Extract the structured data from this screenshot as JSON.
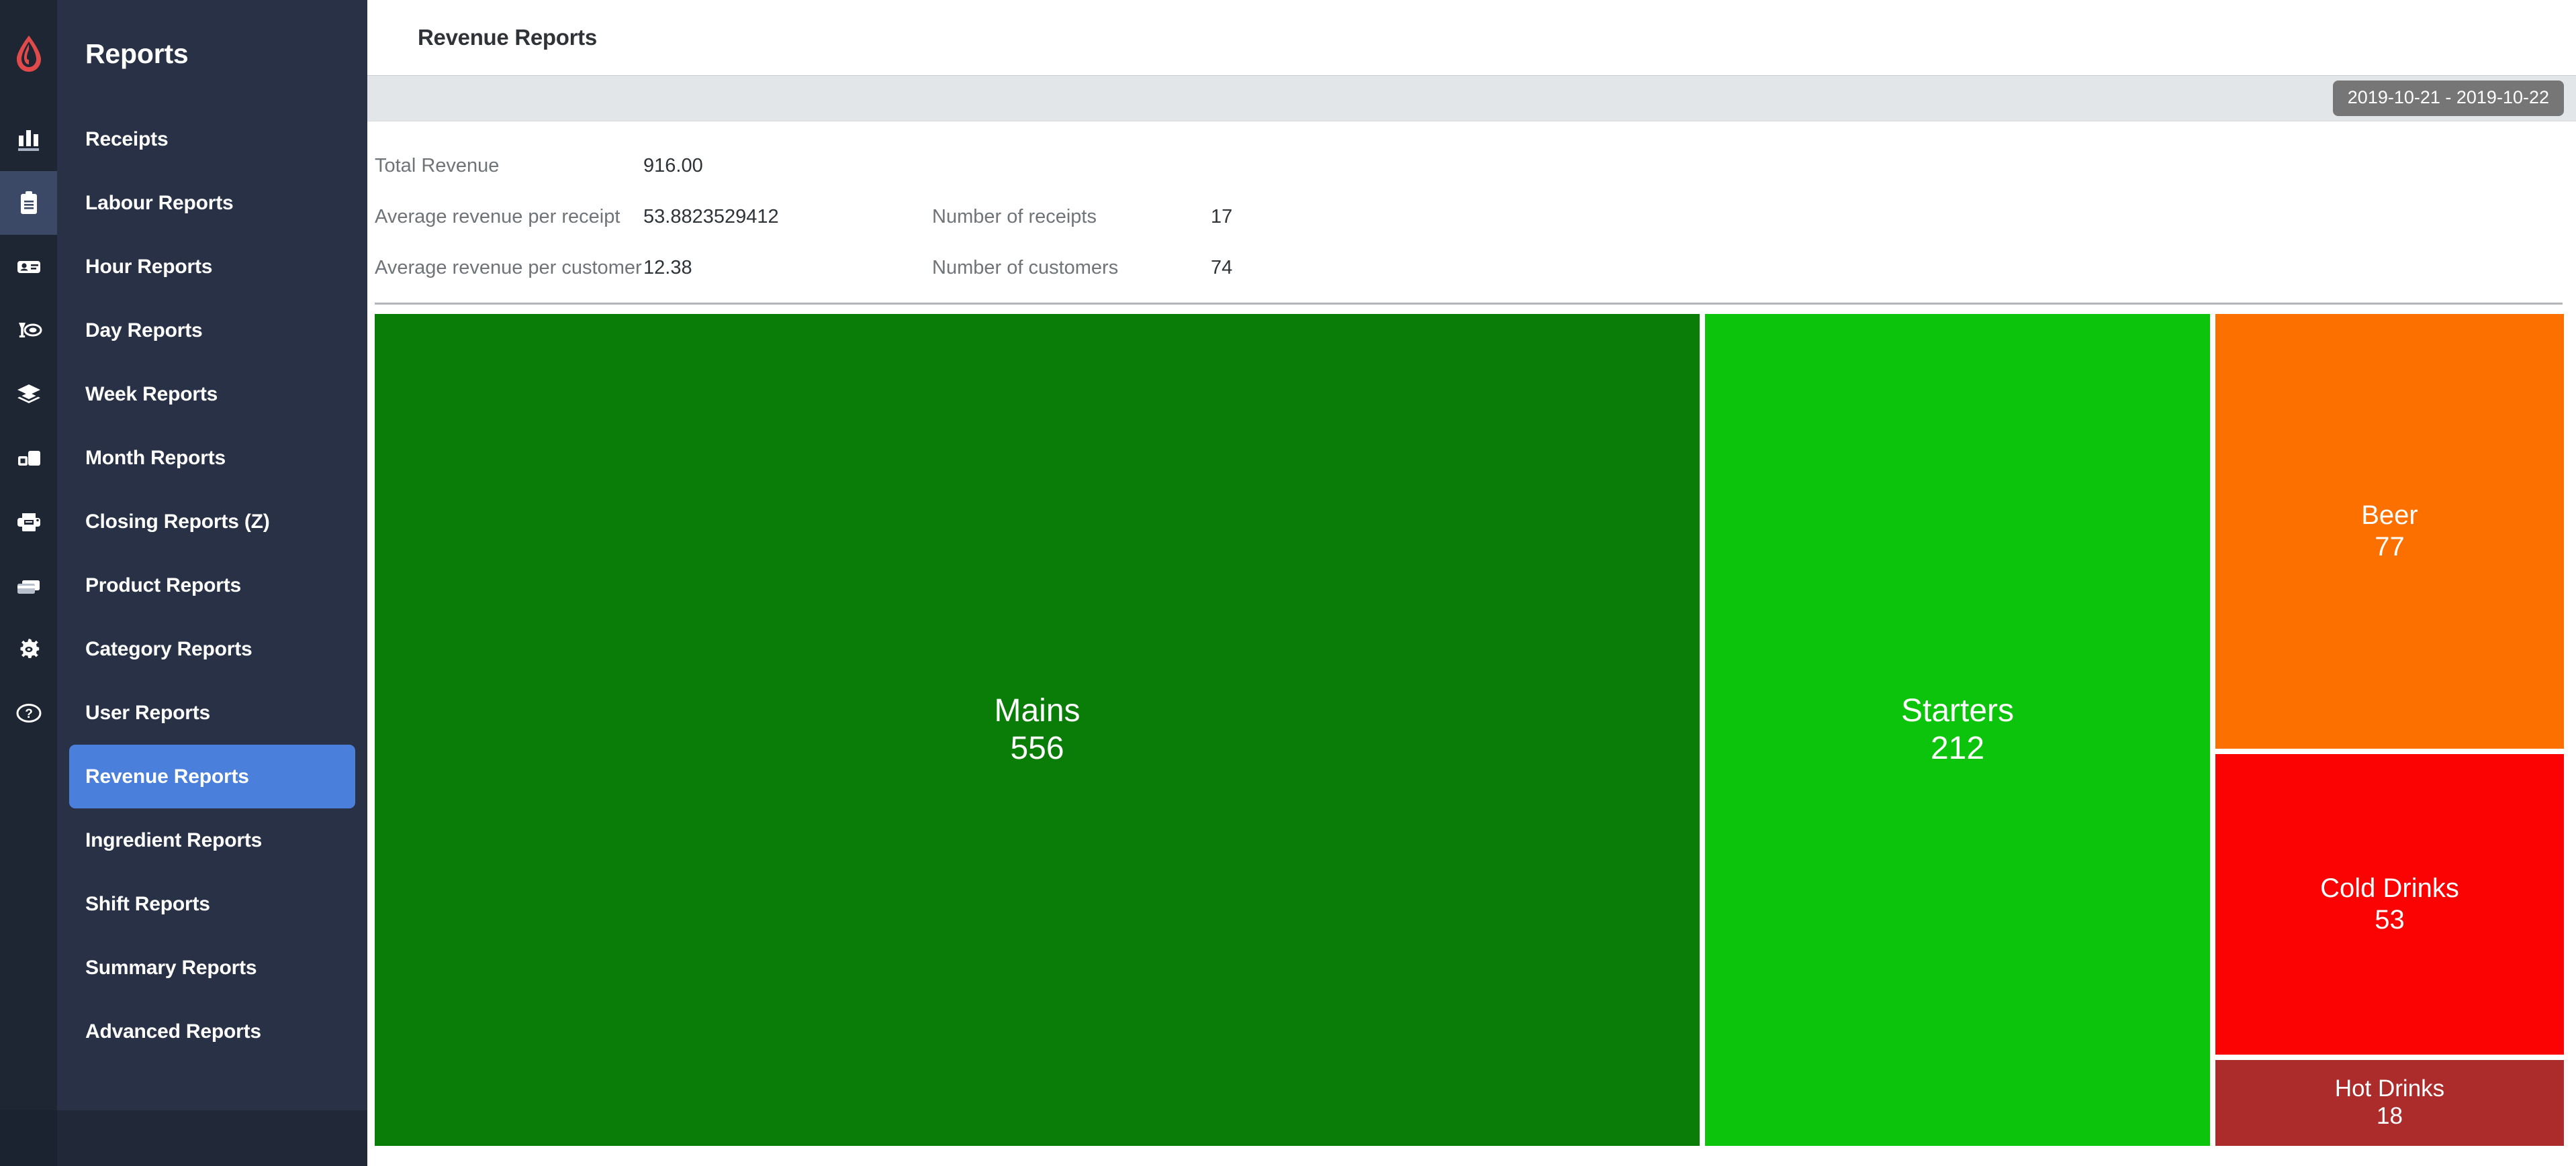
{
  "brand": {
    "logo_icon": "lightspeed-flame-logo",
    "logo_color": "#e04a4a"
  },
  "rail": {
    "items": [
      {
        "icon": "bar-chart-icon",
        "active": false
      },
      {
        "icon": "clipboard-icon",
        "active": true
      },
      {
        "icon": "id-card-icon",
        "active": false
      },
      {
        "icon": "dining-plate-glass-icon",
        "active": false
      },
      {
        "icon": "layers-icon",
        "active": false
      },
      {
        "icon": "devices-icon",
        "active": false
      },
      {
        "icon": "printer-icon",
        "active": false
      },
      {
        "icon": "credit-cards-icon",
        "active": false
      },
      {
        "icon": "gear-icon",
        "active": false
      },
      {
        "icon": "help-circle-icon",
        "active": false
      }
    ]
  },
  "sidebar": {
    "title": "Reports",
    "items": [
      {
        "label": "Receipts",
        "active": false
      },
      {
        "label": "Labour Reports",
        "active": false
      },
      {
        "label": "Hour Reports",
        "active": false
      },
      {
        "label": "Day Reports",
        "active": false
      },
      {
        "label": "Week Reports",
        "active": false
      },
      {
        "label": "Month Reports",
        "active": false
      },
      {
        "label": "Closing Reports (Z)",
        "active": false
      },
      {
        "label": "Product Reports",
        "active": false
      },
      {
        "label": "Category Reports",
        "active": false
      },
      {
        "label": "User Reports",
        "active": false
      },
      {
        "label": "Revenue Reports",
        "active": true
      },
      {
        "label": "Ingredient Reports",
        "active": false
      },
      {
        "label": "Shift Reports",
        "active": false
      },
      {
        "label": "Summary Reports",
        "active": false
      },
      {
        "label": "Advanced Reports",
        "active": false
      }
    ],
    "active_color": "#4a7fdb"
  },
  "header": {
    "title": "Revenue Reports"
  },
  "toolbar": {
    "date_range": "2019-10-21 - 2019-10-22",
    "badge_color": "#767676"
  },
  "stats": {
    "total_revenue_label": "Total Revenue",
    "total_revenue_value": "916.00",
    "avg_per_receipt_label": "Average revenue per receipt",
    "avg_per_receipt_value": "53.8823529412",
    "num_receipts_label": "Number of receipts",
    "num_receipts_value": "17",
    "avg_per_customer_label": "Average revenue per customer",
    "avg_per_customer_value": "12.38",
    "num_customers_label": "Number of customers",
    "num_customers_value": "74"
  },
  "chart_data": {
    "type": "treemap",
    "title": "Revenue Reports",
    "value_unit": "revenue",
    "total": 916,
    "categories": [
      "Mains",
      "Starters",
      "Beer",
      "Cold Drinks",
      "Hot Drinks"
    ],
    "values": [
      556,
      212,
      77,
      53,
      18
    ],
    "colors": [
      "#0a7d08",
      "#0dc40c",
      "#fc7000",
      "#fb0303",
      "#ac2c2c"
    ],
    "tiles": [
      {
        "name": "Mains",
        "value": "556",
        "color": "#0a7d08"
      },
      {
        "name": "Starters",
        "value": "212",
        "color": "#0dc40c"
      },
      {
        "name": "Beer",
        "value": "77",
        "color": "#fc7000"
      },
      {
        "name": "Cold Drinks",
        "value": "53",
        "color": "#fb0303"
      },
      {
        "name": "Hot Drinks",
        "value": "18",
        "color": "#ac2c2c"
      }
    ],
    "legend": "none",
    "grid": false
  }
}
